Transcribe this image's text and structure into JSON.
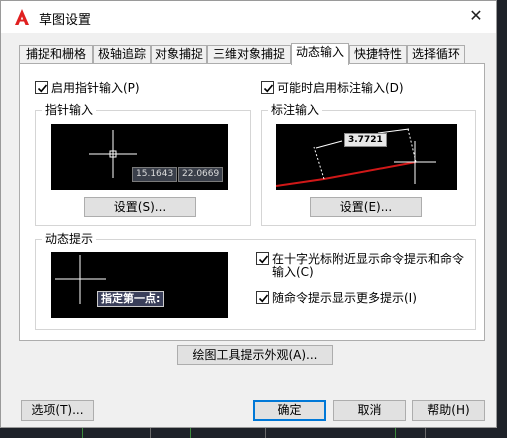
{
  "window": {
    "title": "草图设置",
    "close_glyph": "✕"
  },
  "tabs": [
    {
      "label": "捕捉和栅格",
      "active": false
    },
    {
      "label": "极轴追踪",
      "active": false
    },
    {
      "label": "对象捕捉",
      "active": false
    },
    {
      "label": "三维对象捕捉",
      "active": false
    },
    {
      "label": "动态输入",
      "active": true
    },
    {
      "label": "快捷特性",
      "active": false
    },
    {
      "label": "选择循环",
      "active": false
    }
  ],
  "pointer_input": {
    "enable_label": "启用指针输入(P)",
    "enabled": true,
    "group_title": "指针输入",
    "coord_x": "15.1643",
    "coord_y": "22.0669",
    "settings_label": "设置(S)..."
  },
  "dimension_input": {
    "enable_label": "可能时启用标注输入(D)",
    "enabled": true,
    "group_title": "标注输入",
    "dim_value": "3.7721",
    "settings_label": "设置(E)..."
  },
  "dynamic_prompts": {
    "group_title": "动态提示",
    "tooltip_text": "指定第一点:",
    "show_near_crosshair_label_line1": "在十字光标附近显示命令提示和命令",
    "show_near_crosshair_label_line2": "输入(C)",
    "show_near_crosshair": true,
    "show_more_label": "随命令提示显示更多提示(I)",
    "show_more": true
  },
  "drafting_tooltip_button": "绘图工具提示外观(A)...",
  "footer": {
    "options_label": "选项(T)...",
    "ok_label": "确定",
    "cancel_label": "取消",
    "help_label": "帮助(H)"
  },
  "colors": {
    "accent": "#0078d7",
    "brand_red": "#e02020",
    "dim_line": "#d01818"
  }
}
